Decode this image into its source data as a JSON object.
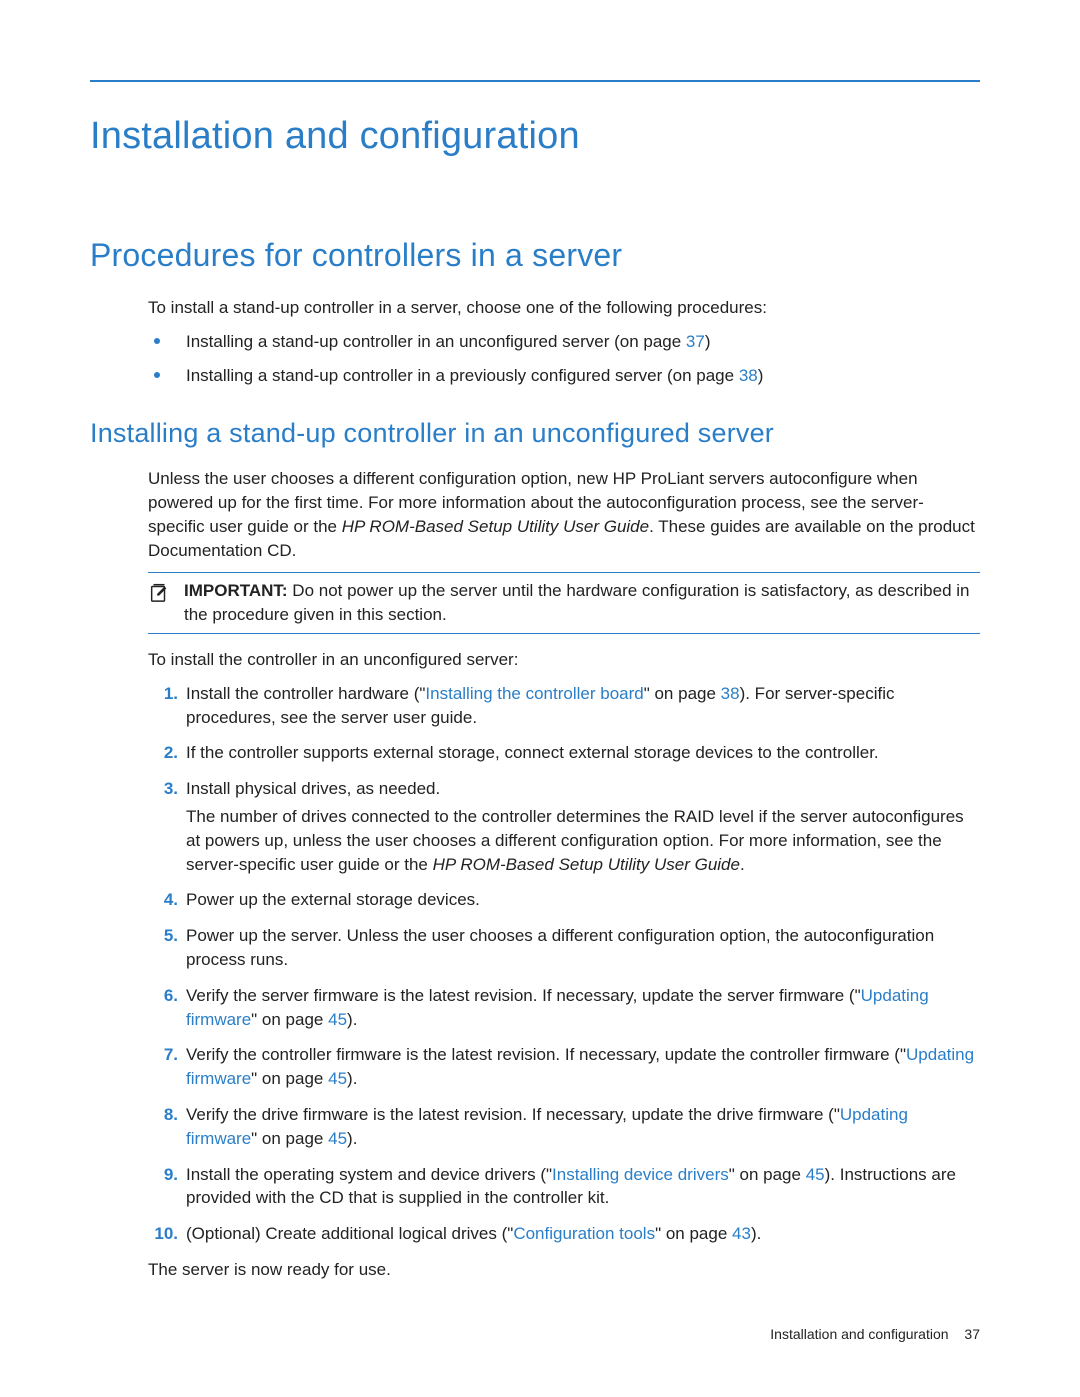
{
  "chapter_title": "Installation and configuration",
  "section_title": "Procedures for controllers in a server",
  "intro_line": "To install a stand-up controller in a server, choose one of the following procedures:",
  "bullets": [
    {
      "pre": "Installing a stand-up controller in an unconfigured server (on page ",
      "page": "37",
      "post": ")"
    },
    {
      "pre": "Installing a stand-up controller in a previously configured server (on page ",
      "page": "38",
      "post": ")"
    }
  ],
  "subsection_title": "Installing a stand-up controller in an unconfigured server",
  "para_unless_1": "Unless the user chooses a different configuration option, new HP ProLiant servers autoconfigure when powered up for the first time. For more information about the autoconfiguration process, see the server-specific user guide or the ",
  "rom_guide_italic": "HP ROM-Based Setup Utility User Guide",
  "para_unless_2": ". These guides are available on the product Documentation CD.",
  "important_label": "IMPORTANT:",
  "important_text": "  Do not power up the server until the hardware configuration is satisfactory, as described in the procedure given in this section.",
  "to_install_line": "To install the controller in an unconfigured server:",
  "steps": {
    "s1": {
      "num": "1.",
      "a": "Install the controller hardware (\"",
      "link": "Installing the controller board",
      "b": "\" on page ",
      "page": "38",
      "c": "). For server-specific procedures, see the server user guide."
    },
    "s2": {
      "num": "2.",
      "text": "If the controller supports external storage, connect external storage devices to the controller."
    },
    "s3": {
      "num": "3.",
      "text": "Install physical drives, as needed.",
      "extra_a": "The number of drives connected to the controller determines the RAID level if the server autoconfigures at powers up, unless the user chooses a different configuration option. For more information, see the server-specific user guide or the ",
      "extra_b": "."
    },
    "s4": {
      "num": "4.",
      "text": "Power up the external storage devices."
    },
    "s5": {
      "num": "5.",
      "text": "Power up the server. Unless the user chooses a different configuration option, the autoconfiguration process runs."
    },
    "s6": {
      "num": "6.",
      "a": "Verify the server firmware is the latest revision. If necessary, update the server firmware (\"",
      "link": "Updating firmware",
      "b": "\" on page ",
      "page": "45",
      "c": ")."
    },
    "s7": {
      "num": "7.",
      "a": "Verify the controller firmware is the latest revision. If necessary, update the controller firmware (\"",
      "link": "Updating firmware",
      "b": "\" on page ",
      "page": "45",
      "c": ")."
    },
    "s8": {
      "num": "8.",
      "a": "Verify the drive firmware is the latest revision. If necessary, update the drive firmware (\"",
      "link": "Updating firmware",
      "b": "\" on page ",
      "page": "45",
      "c": ")."
    },
    "s9": {
      "num": "9.",
      "a": "Install the operating system and device drivers (\"",
      "link": "Installing device drivers",
      "b": "\" on page ",
      "page": "45",
      "c": "). Instructions are provided with the CD that is supplied in the controller kit."
    },
    "s10": {
      "num": "10.",
      "a": "(Optional) Create additional logical drives (\"",
      "link": "Configuration tools",
      "b": "\" on page ",
      "page": "43",
      "c": ")."
    }
  },
  "closing_line": "The server is now ready for use.",
  "footer_text": "Installation and configuration",
  "footer_page": "37",
  "colors": {
    "accent": "#2a7ec8"
  }
}
